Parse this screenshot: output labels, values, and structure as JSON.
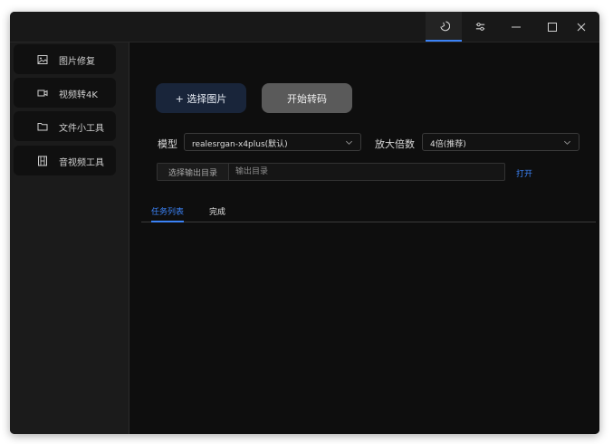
{
  "titlebar": {
    "buttons": [
      {
        "name": "theme-toggle",
        "icon": "moon-icon"
      },
      {
        "name": "settings",
        "icon": "sliders-icon"
      },
      {
        "name": "minimize",
        "icon": "minimize-icon"
      },
      {
        "name": "maximize",
        "icon": "maximize-icon"
      },
      {
        "name": "close",
        "icon": "close-icon"
      }
    ]
  },
  "sidebar": {
    "items": [
      {
        "label": "图片修复",
        "icon": "image-icon"
      },
      {
        "label": "视频转4K",
        "icon": "video-camera-icon"
      },
      {
        "label": "文件小工具",
        "icon": "folder-icon"
      },
      {
        "label": "音视频工具",
        "icon": "film-icon"
      }
    ]
  },
  "actions": {
    "select_images": "+ 选择图片",
    "start_transcode": "开始转码"
  },
  "model": {
    "label": "模型",
    "value": "realesrgan-x4plus(默认)"
  },
  "scale": {
    "label": "放大倍数",
    "value": "4倍(推荐)"
  },
  "output": {
    "button": "选择输出目录",
    "placeholder": "输出目录",
    "open": "打开"
  },
  "tabs": [
    {
      "label": "任务列表",
      "active": true
    },
    {
      "label": "完成",
      "active": false
    }
  ],
  "colors": {
    "accent": "#3b82f6",
    "window_bg": "#0e0e0e",
    "sidebar_bg": "#1b1b1b",
    "primary_button": "#19253a",
    "secondary_button": "#5a5a5a"
  }
}
